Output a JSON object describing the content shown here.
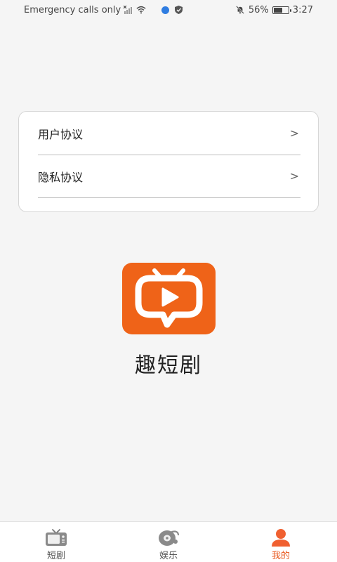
{
  "status_bar": {
    "carrier_text": "Emergency calls only",
    "battery_percent": "56%",
    "battery_level": 0.56,
    "time": "3:27"
  },
  "agreements": {
    "items": [
      {
        "label": "用户协议",
        "chevron": ">"
      },
      {
        "label": "隐私协议",
        "chevron": ">"
      }
    ]
  },
  "app": {
    "name": "趣短剧",
    "logo_color": "#ef6318"
  },
  "bottom_nav": {
    "items": [
      {
        "label": "短剧",
        "icon": "tv-icon",
        "active": false
      },
      {
        "label": "娱乐",
        "icon": "disc-icon",
        "active": false
      },
      {
        "label": "我的",
        "icon": "person-icon",
        "active": true
      }
    ],
    "active_color": "#e8561b",
    "inactive_color": "#555555"
  }
}
